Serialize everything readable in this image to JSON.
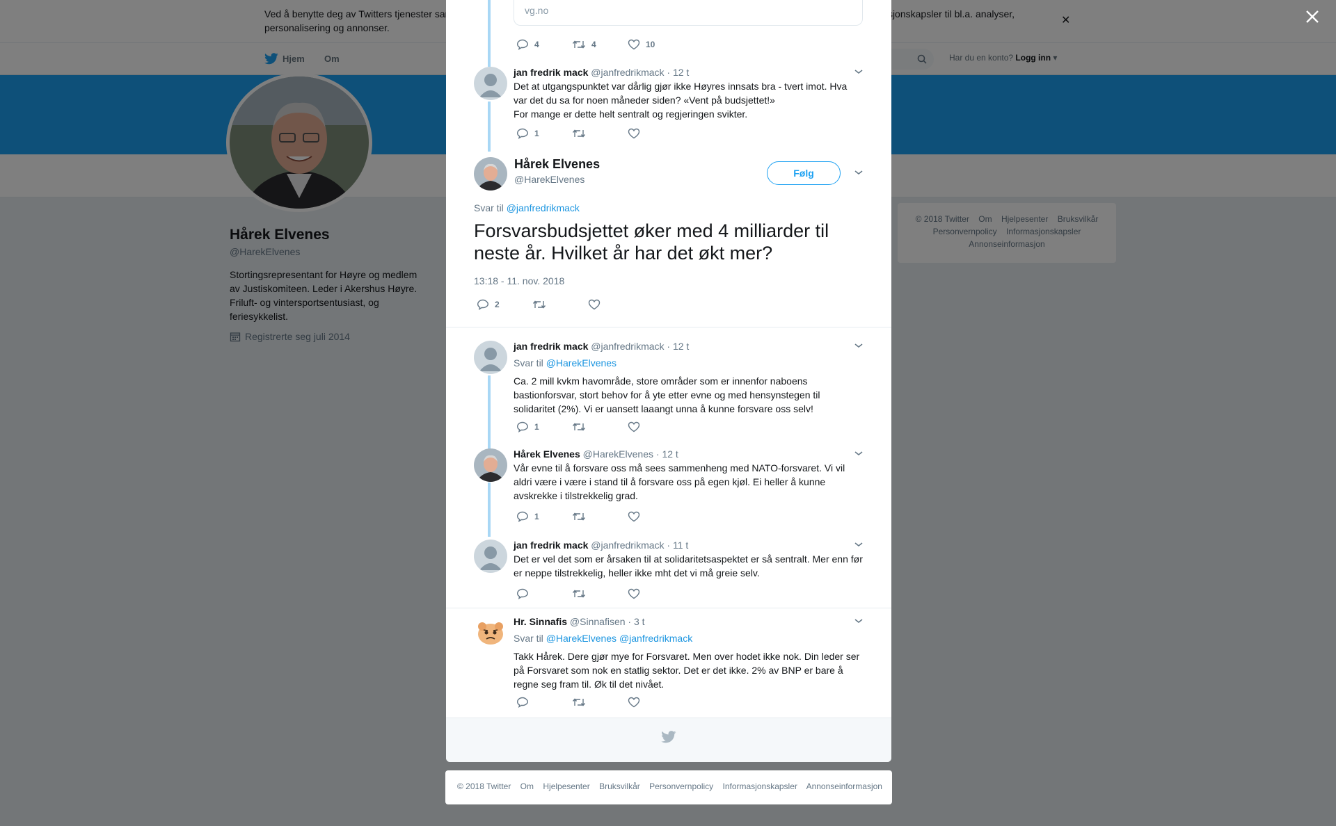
{
  "cookie": {
    "text": "Ved å benytte deg av Twitters tjenester samtykker du i at vi og våre partnere benytter informasjonskapsler på og utenfor Twitter, inkludert informasjonskapsler til bl.a. analyser, personalisering og annonser."
  },
  "nav": {
    "home": "Hjem",
    "about": "Om",
    "login_question": "Har du en konto?",
    "login": "Logg inn"
  },
  "profile": {
    "name": "Hårek Elvenes",
    "handle": "@HarekElvenes",
    "bio": "Stortingsrepresentant for Høyre og medlem av Justiskomiteen. Leder i Akershus Høyre. Friluft- og vintersportsentusiast, og feriesykkelist.",
    "joined": "Registrerte seg juli 2014"
  },
  "side_footer": {
    "items": [
      "© 2018 Twitter",
      "Om",
      "Hjelpesenter",
      "Bruksvilkår",
      "Personvernpolicy",
      "Informasjonskapsler",
      "Annonseinformasjon"
    ]
  },
  "card": {
    "domain": "vg.no"
  },
  "top_actions": {
    "replies": "4",
    "retweets": "4",
    "likes": "10"
  },
  "tweet1": {
    "name": "jan fredrik mack",
    "handle": "@janfredrikmack",
    "time": "· 12 t",
    "text1": "Det at utgangspunktet var dårlig gjør ikke Høyres innsats bra - tvert imot. Hva var det du sa for noen måneder siden? «Vent på budsjettet!»",
    "text2": "For mange er dette helt sentralt og regjeringen svikter.",
    "replies": "1"
  },
  "main": {
    "name": "Hårek Elvenes",
    "handle": "@HarekElvenes",
    "follow": "Følg",
    "reply_label": "Svar til",
    "reply_to": "@janfredrikmack",
    "text": "Forsvarsbudsjettet øker med 4 milliarder til neste år. Hvilket år har det økt mer?",
    "time": "13:18 - 11. nov. 2018",
    "replies": "2"
  },
  "tweet2": {
    "name": "jan fredrik mack",
    "handle": "@janfredrikmack",
    "time": "· 12 t",
    "reply_label": "Svar til",
    "reply_to": "@HarekElvenes",
    "text": "Ca. 2 mill kvkm havområde, store områder som er innenfor naboens bastionforsvar, stort behov for å yte etter evne og med hensynstegen til solidaritet (2%).  Vi er uansett laaangt unna å kunne forsvare oss selv!",
    "replies": "1"
  },
  "tweet3": {
    "name": "Hårek Elvenes",
    "handle": "@HarekElvenes",
    "time": "· 12 t",
    "text": "Vår evne til å forsvare oss må sees sammenheng med NATO-forsvaret. Vi vil aldri være i være i stand til å forsvare oss på egen kjøl. Ei heller å kunne avskrekke i tilstrekkelig grad.",
    "replies": "1"
  },
  "tweet4": {
    "name": "jan fredrik mack",
    "handle": "@janfredrikmack",
    "time": "· 11 t",
    "text": "Det er vel det som er årsaken til at solidaritetsaspektet er så sentralt. Mer enn før er neppe tilstrekkelig, heller ikke mht det vi må greie selv."
  },
  "tweet5": {
    "name": "Hr. Sinnafis",
    "handle": "@Sinnafisen",
    "time": "· 3 t",
    "reply_label": "Svar til",
    "reply_to1": "@HarekElvenes",
    "reply_to2": "@janfredrikmack",
    "text": "Takk Hårek. Dere gjør mye for Forsvaret. Men over hodet ikke nok. Din leder ser på Forsvaret som nok en statlig sektor. Det er det ikke. 2% av BNP er bare å regne seg fram til. Øk til det nivået."
  },
  "footer": {
    "items": [
      "© 2018 Twitter",
      "Om",
      "Hjelpesenter",
      "Bruksvilkår",
      "Personvernpolicy",
      "Informasjonskapsler",
      "Annonseinformasjon"
    ]
  },
  "colors": {
    "twitter_blue": "#1da1f2",
    "link": "#1b95e0",
    "muted": "#657786",
    "thread": "#a8d7f5"
  }
}
